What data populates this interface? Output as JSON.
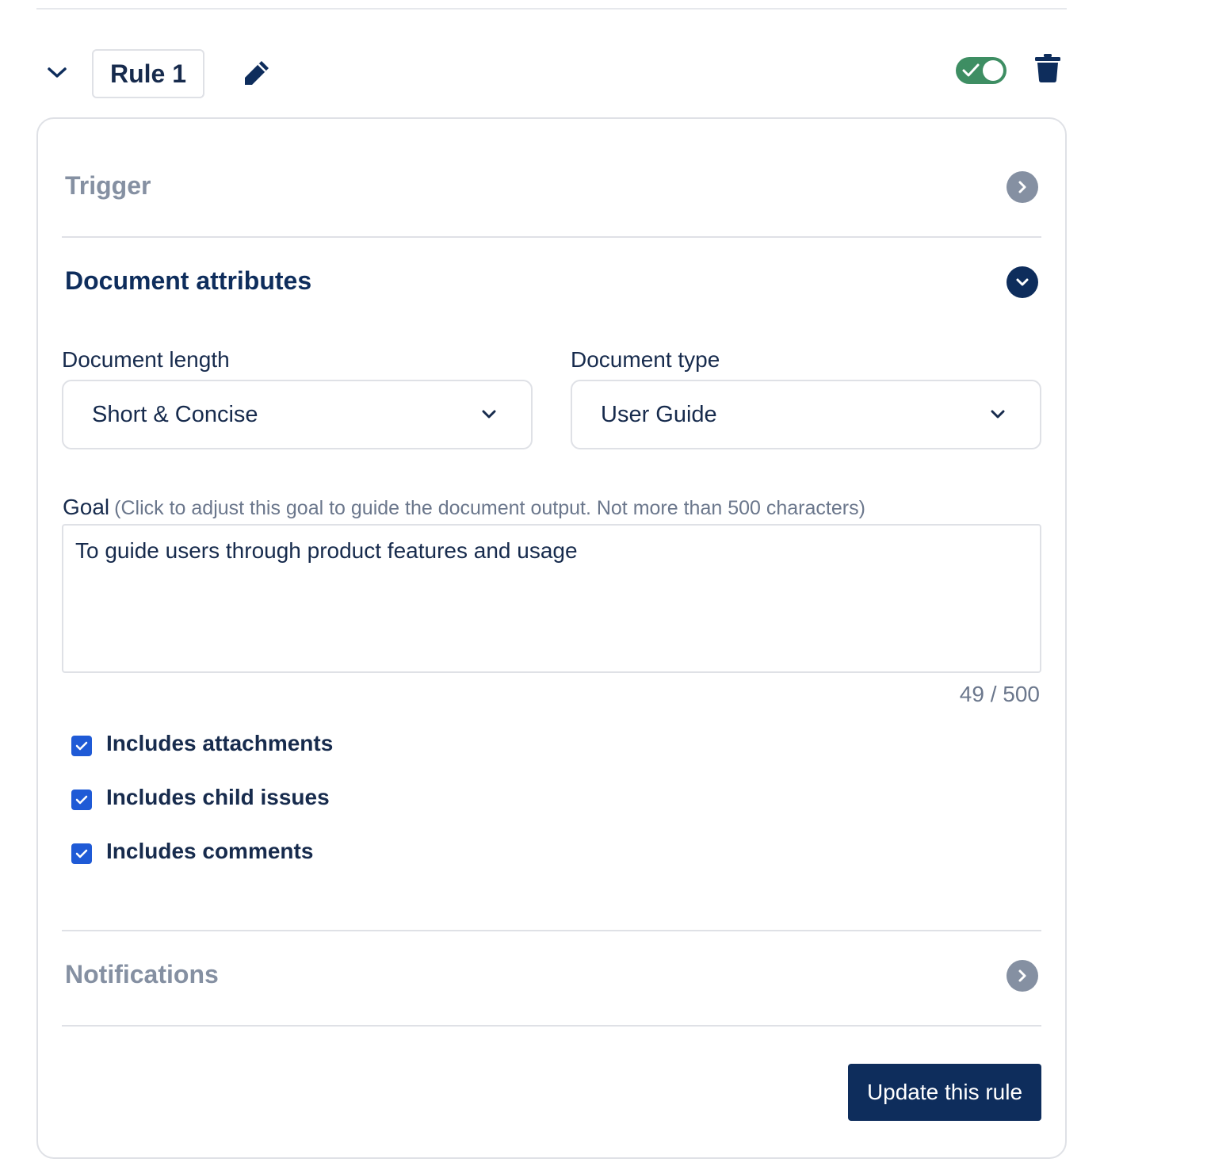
{
  "rule": {
    "name": "Rule 1",
    "enabled": true
  },
  "icons": {
    "collapse": "chevron-down-icon",
    "edit": "pencil-icon",
    "delete": "trash-icon",
    "toggle_check": "check-icon"
  },
  "sections": {
    "trigger": {
      "title": "Trigger",
      "expanded": false
    },
    "document_attributes": {
      "title": "Document attributes",
      "expanded": true
    },
    "notifications": {
      "title": "Notifications",
      "expanded": false
    }
  },
  "form": {
    "length_label": "Document length",
    "length_value": "Short & Concise",
    "type_label": "Document type",
    "type_value": "User Guide",
    "goal_label": "Goal",
    "goal_hint": "(Click to adjust this goal to guide the document output. Not more than 500 characters)",
    "goal_value": "To guide users through product features and usage",
    "goal_counter": "49 / 500",
    "checkboxes": [
      {
        "label": "Includes attachments",
        "checked": true
      },
      {
        "label": "Includes child issues",
        "checked": true
      },
      {
        "label": "Includes comments",
        "checked": true
      }
    ]
  },
  "actions": {
    "update_label": "Update this rule"
  },
  "colors": {
    "primary": "#0e2d5c",
    "toggle_on": "#3e8e63",
    "checkbox": "#1f5ad6",
    "muted": "#8590a2"
  }
}
